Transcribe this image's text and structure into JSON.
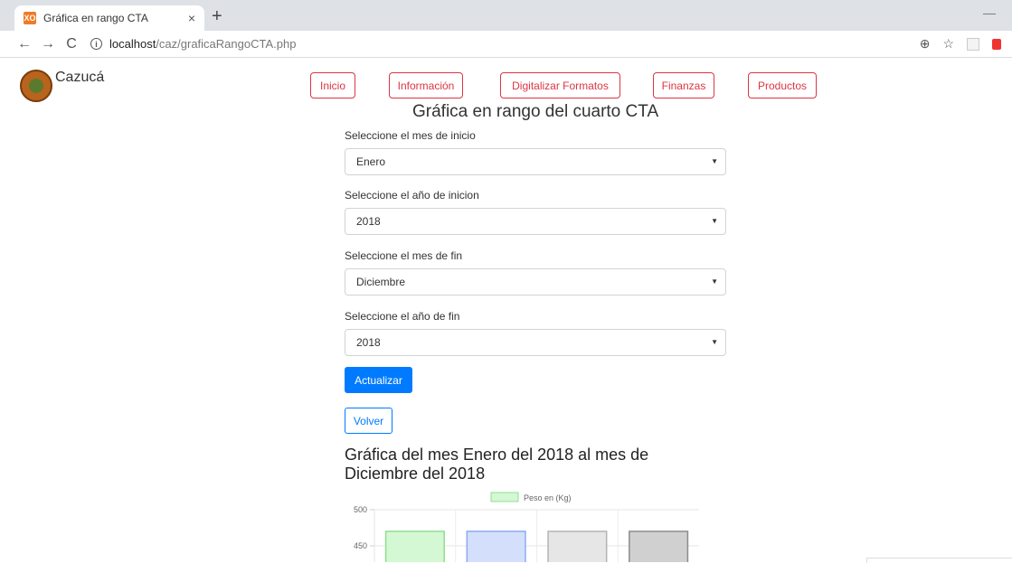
{
  "browser": {
    "tab_title": "Gráfica en rango CTA",
    "tab_close": "×",
    "new_tab": "+",
    "favicon_text": "XO",
    "url_host": "localhost",
    "url_path": "/caz/graficaRangoCTA.php",
    "back": "←",
    "forward": "→",
    "reload": "C",
    "zoom": "⊕",
    "star": "☆",
    "minimize": "—"
  },
  "brand": {
    "name": "Cazucá"
  },
  "nav": {
    "items": [
      {
        "label": "Inicio"
      },
      {
        "label": "Información"
      },
      {
        "label": "Digitalizar Formatos"
      },
      {
        "label": "Finanzas"
      },
      {
        "label": "Productos"
      }
    ]
  },
  "page": {
    "title": "Gráfica en rango del cuarto CTA",
    "form": {
      "start_month_label": "Seleccione el mes de inicio",
      "start_month_value": "Enero",
      "start_year_label": "Seleccione el año de inicion",
      "start_year_value": "2018",
      "end_month_label": "Seleccione el mes de fin",
      "end_month_value": "Diciembre",
      "end_year_label": "Seleccione el año de fin",
      "end_year_value": "2018",
      "caret": "▼"
    },
    "update_button": "Actualizar",
    "back_button": "Volver",
    "chart_heading": "Gráfica del mes Enero del 2018 al mes de Diciembre del 2018"
  },
  "colors": {
    "nav_accent": "#dc3545",
    "primary": "#007bff"
  },
  "chart_data": {
    "type": "bar",
    "legend": "Peso en (Kg)",
    "ylim_visible": [
      440,
      500
    ],
    "y_ticks": [
      "500",
      "450"
    ],
    "values": [
      470,
      470,
      470,
      470
    ],
    "bar_fills": [
      "#d4f7d4",
      "#d4e0fb",
      "#e6e6e6",
      "#d0d0d0"
    ],
    "bar_strokes": [
      "#8fe08f",
      "#8fa9ef",
      "#b3b3b3",
      "#8c8c8c"
    ]
  }
}
